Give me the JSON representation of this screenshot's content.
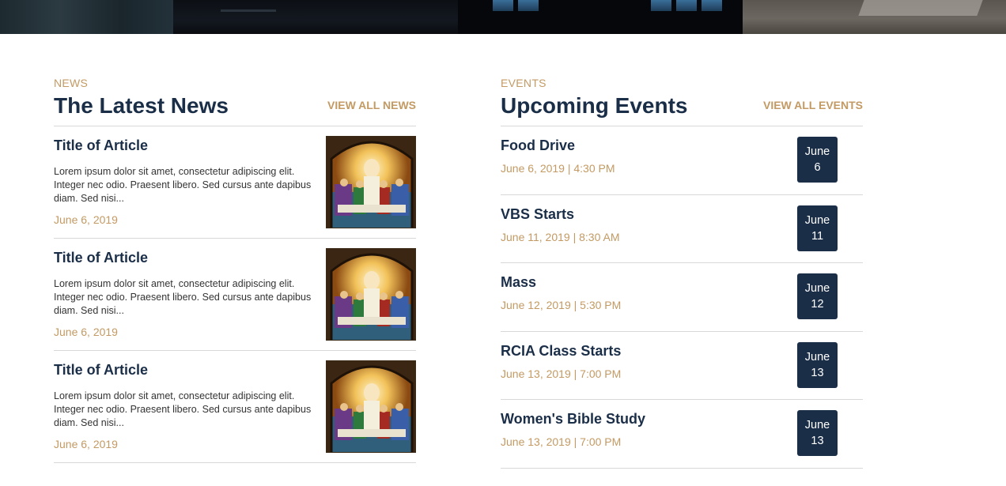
{
  "news": {
    "eyebrow": "NEWS",
    "title": "The Latest News",
    "view_all": "VIEW ALL NEWS",
    "items": [
      {
        "title": "Title of Article",
        "excerpt": "Lorem ipsum dolor sit amet, consectetur adipiscing elit. Integer nec odio. Praesent libero. Sed cursus ante dapibus diam. Sed nisi...",
        "date": "June 6, 2019"
      },
      {
        "title": "Title of Article",
        "excerpt": "Lorem ipsum dolor sit amet, consectetur adipiscing elit. Integer nec odio. Praesent libero. Sed cursus ante dapibus diam. Sed nisi...",
        "date": "June 6, 2019"
      },
      {
        "title": "Title of Article",
        "excerpt": "Lorem ipsum dolor sit amet, consectetur adipiscing elit. Integer nec odio. Praesent libero. Sed cursus ante dapibus diam. Sed nisi...",
        "date": "June 6, 2019"
      }
    ]
  },
  "events": {
    "eyebrow": "EVENTS",
    "title": "Upcoming Events",
    "view_all": "VIEW ALL EVENTS",
    "items": [
      {
        "title": "Food Drive",
        "when": "June 6, 2019 | 4:30 PM",
        "month": "June",
        "day": "6"
      },
      {
        "title": "VBS Starts",
        "when": "June 11, 2019 | 8:30 AM",
        "month": "June",
        "day": "11"
      },
      {
        "title": "Mass",
        "when": "June 12, 2019 | 5:30 PM",
        "month": "June",
        "day": "12"
      },
      {
        "title": "RCIA Class Starts",
        "when": "June 13, 2019 | 7:00 PM",
        "month": "June",
        "day": "13"
      },
      {
        "title": "Women's Bible Study",
        "when": "June 13, 2019 | 7:00 PM",
        "month": "June",
        "day": "13"
      }
    ]
  },
  "colors": {
    "navy": "#1b2e48",
    "gold": "#c39a63",
    "divider": "#d8d8d8"
  }
}
